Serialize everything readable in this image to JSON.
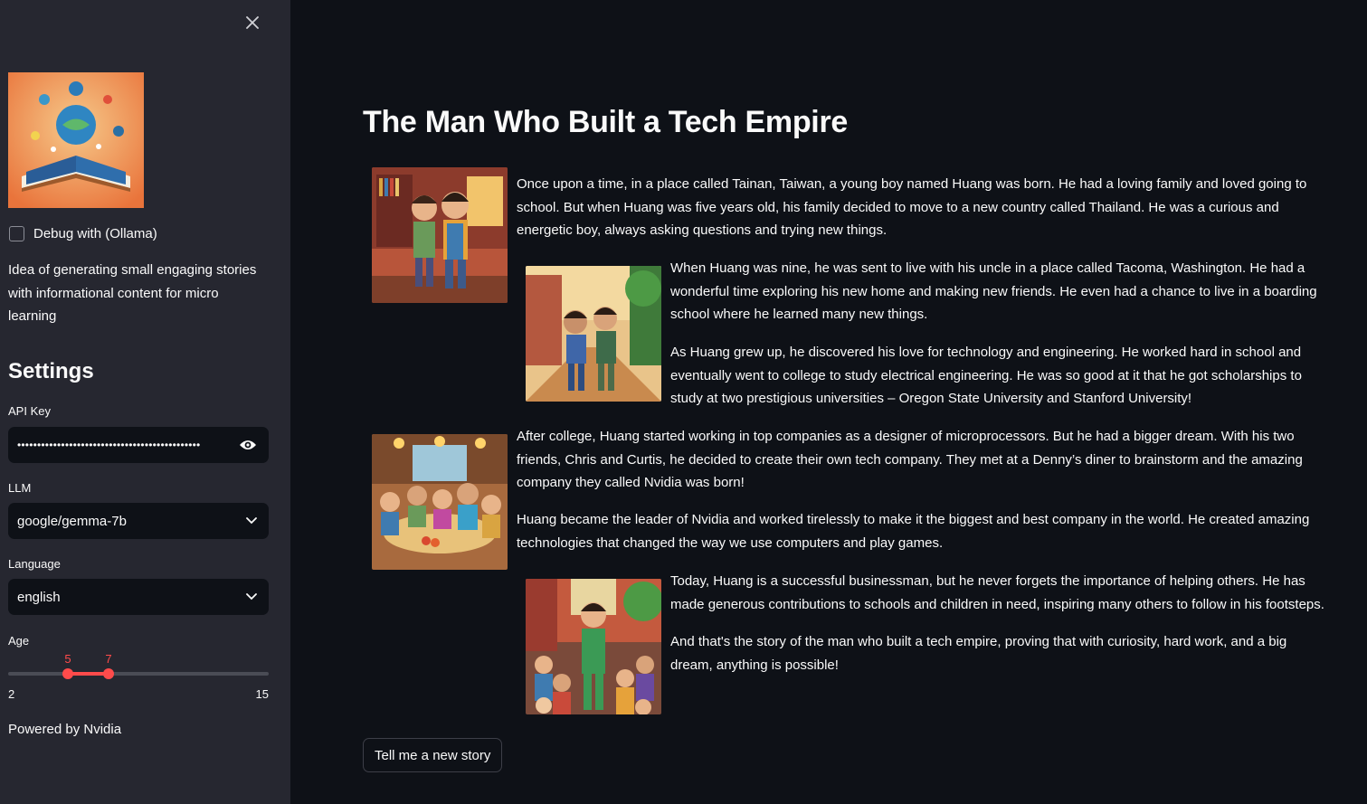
{
  "sidebar": {
    "close_icon": "close-icon",
    "logo": "story-book-logo",
    "debug_label": "Debug with (Ollama)",
    "debug_checked": false,
    "intro": "Idea of generating small engaging stories with informational content for micro learning",
    "settings_title": "Settings",
    "api_key": {
      "label": "API Key",
      "value": "••••••••••••••••••••••••••••••••••••••••••••••"
    },
    "llm": {
      "label": "LLM",
      "value": "google/gemma-7b"
    },
    "language": {
      "label": "Language",
      "value": "english"
    },
    "age": {
      "label": "Age",
      "min": "2",
      "max": "15",
      "low": "5",
      "high": "7",
      "range_min": 2,
      "range_max": 15,
      "low_value": 5,
      "high_value": 7
    },
    "powered_by": "Powered by Nvidia"
  },
  "main": {
    "title": "The Man Who Built a Tech Empire",
    "paragraphs": [
      "Once upon a time, in a place called Tainan, Taiwan, a young boy named Huang was born. He had a loving family and loved going to school. But when Huang was five years old, his family decided to move to a new country called Thailand. He was a curious and energetic boy, always asking questions and trying new things.",
      "When Huang was nine, he was sent to live with his uncle in a place called Tacoma, Washington. He had a wonderful time exploring his new home and making new friends. He even had a chance to live in a boarding school where he learned many new things.",
      "As Huang grew up, he discovered his love for technology and engineering. He worked hard in school and eventually went to college to study electrical engineering. He was so good at it that he got scholarships to study at two prestigious universities – Oregon State University and Stanford University!",
      "After college, Huang started working in top companies as a designer of microprocessors. But he had a bigger dream. With his two friends, Chris and Curtis, he decided to create their own tech company. They met at a Denny’s diner to brainstorm and the amazing company they called Nvidia was born!",
      "Huang became the leader of Nvidia and worked tirelessly to make it the biggest and best company in the world. He created amazing technologies that changed the way we use computers and play games.",
      "Today, Huang is a successful businessman, but he never forgets the importance of helping others. He has made generous contributions to schools and children in need, inspiring many others to follow in his footsteps.",
      "And that's the story of the man who built a tech empire, proving that with curiosity, hard work, and a big dream, anything is possible!"
    ],
    "new_story_button": "Tell me a new story"
  },
  "colors": {
    "app_bg": "#0e1117",
    "sidebar_bg": "#262730",
    "accent": "#ff4b4b",
    "text": "#fafafa"
  }
}
